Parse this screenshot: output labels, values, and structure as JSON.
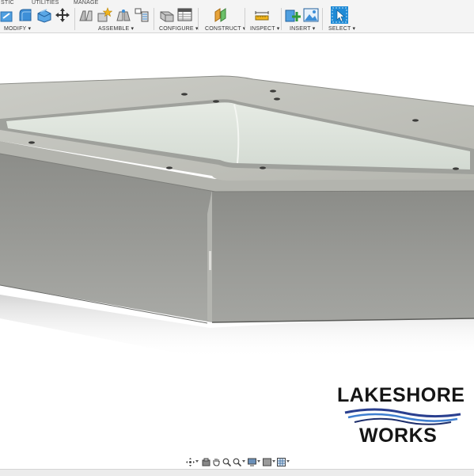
{
  "toolbar": {
    "tabs": [
      {
        "label": "STIC"
      },
      {
        "label": "UTILITIES"
      },
      {
        "label": "MANAGE"
      }
    ],
    "groups": [
      {
        "label": "MODIFY ▾"
      },
      {
        "label": "ASSEMBLE ▾"
      },
      {
        "label": "CONFIGURE ▾"
      },
      {
        "label": "CONSTRUCT ▾"
      },
      {
        "label": "INSPECT ▾"
      },
      {
        "label": "INSERT ▾"
      },
      {
        "label": "SELECT ▾"
      }
    ],
    "icons": [
      "press-pull-icon",
      "fillet-icon",
      "shell-icon",
      "move-icon",
      "new-component-icon",
      "joint-icon",
      "as-built-joint-icon",
      "joint-origin-icon",
      "configure-icon",
      "parameters-table-icon",
      "offset-plane-icon",
      "measure-icon",
      "insert-derive-icon",
      "insert-canvas-icon",
      "select-icon"
    ]
  },
  "logo": {
    "line1": "LAKESHORE",
    "line2": "WORKS",
    "wave_color": "#2a3f8f"
  },
  "navbar": {
    "icons": [
      "orbit-icon",
      "look-at-icon",
      "pan-icon",
      "zoom-icon",
      "zoom-window-icon",
      "display-settings-icon",
      "visual-style-icon",
      "grid-settings-icon"
    ]
  },
  "colors": {
    "accent": "#2a8fd6",
    "model_dark": "#8f8f8b",
    "model_light": "#c9cac4",
    "glass": "#dde4dc"
  }
}
